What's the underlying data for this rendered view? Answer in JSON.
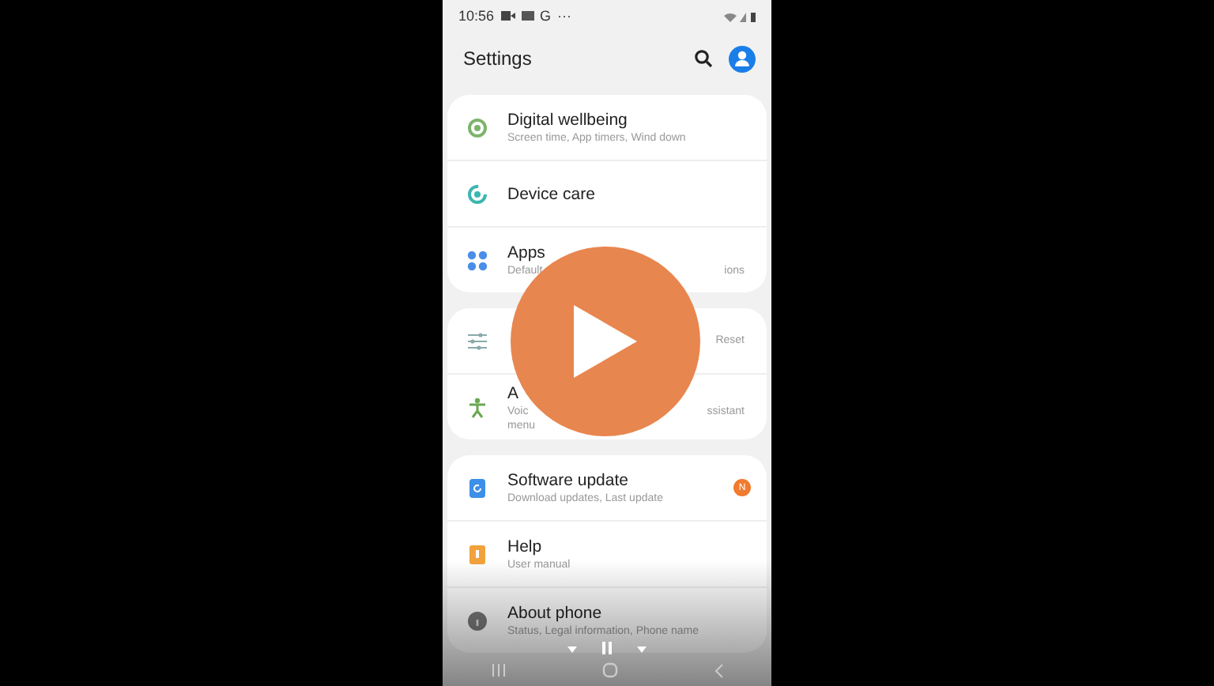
{
  "status_bar": {
    "time": "10:56",
    "app_letter": "G",
    "more": "···"
  },
  "header": {
    "title": "Settings"
  },
  "groups": [
    {
      "items": [
        {
          "kind": "wellbeing",
          "title": "Digital wellbeing",
          "subtitle": [
            {
              "left": "Screen time, App timers, Wind down"
            }
          ]
        },
        {
          "kind": "care",
          "title": "Device care"
        },
        {
          "kind": "apps",
          "title": "Apps",
          "subtitle": [
            {
              "left": "Default",
              "right": "ions"
            }
          ]
        }
      ]
    },
    {
      "items": [
        {
          "kind": "sliders",
          "subtitle": [
            {
              "right": "Reset"
            }
          ]
        },
        {
          "kind": "accessibility",
          "title": "A",
          "subtitle": [
            {
              "left": "Voic",
              "right": "ssistant"
            },
            {
              "left": "menu"
            }
          ]
        }
      ]
    },
    {
      "items": [
        {
          "kind": "update",
          "title": "Software update",
          "subtitle": [
            {
              "left": "Download updates, Last update"
            }
          ],
          "badge": "N"
        },
        {
          "kind": "help",
          "title": "Help",
          "subtitle": [
            {
              "left": "User manual"
            }
          ]
        },
        {
          "kind": "about",
          "title": "About phone",
          "subtitle": [
            {
              "left": "Status, Legal information, Phone name"
            }
          ]
        }
      ]
    }
  ]
}
